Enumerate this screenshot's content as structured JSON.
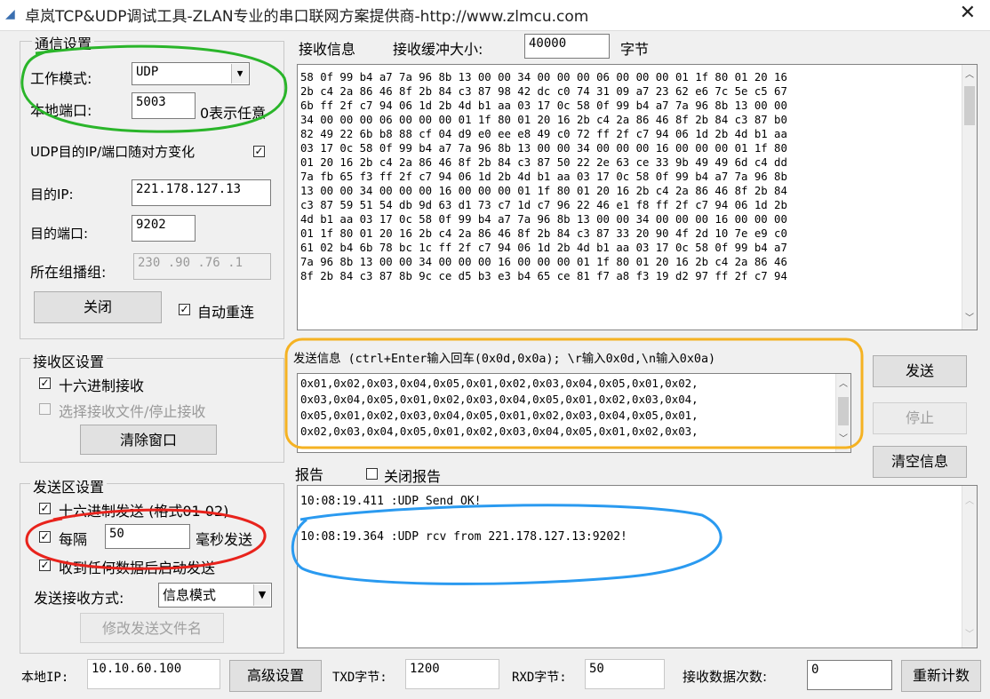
{
  "window": {
    "title": "卓岚TCP&UDP调试工具-ZLAN专业的串口联网方案提供商-http://www.zlmcu.com",
    "close": "✕"
  },
  "comm": {
    "group_title": "通信设置",
    "mode_label": "工作模式:",
    "mode_value": "UDP",
    "port_label": "本地端口:",
    "port_value": "5003",
    "port_hint": "0表示任意",
    "udp_change_label": "UDP目的IP/端口随对方变化",
    "udp_change_checked": "✓",
    "dest_ip_label": "目的IP:",
    "dest_ip_value": "221.178.127.13",
    "dest_port_label": "目的端口:",
    "dest_port_value": "9202",
    "multicast_label": "所在组播组:",
    "multicast_value": "230 .90 .76 .1",
    "close_button": "关闭",
    "auto_reconnect_label": "自动重连",
    "auto_reconnect_checked": "✓"
  },
  "recv_settings": {
    "group_title": "接收区设置",
    "hex_recv_label": "十六进制接收",
    "hex_recv_checked": "✓",
    "select_file_label": "选择接收文件/停止接收",
    "clear_button": "清除窗口"
  },
  "send_settings": {
    "group_title": "发送区设置",
    "hex_send_label": "十六进制发送 (格式01 02)",
    "hex_send_checked": "✓",
    "every_label": "每隔",
    "every_value": "50",
    "every_unit": "毫秒发送",
    "every_checked": "✓",
    "auto_send_label": "收到任何数据后启动发送",
    "auto_send_checked": "✓",
    "mode_label": "发送接收方式:",
    "mode_value": "信息模式",
    "modify_button": "修改发送文件名"
  },
  "receive": {
    "label": "接收信息",
    "buffer_label": "接收缓冲大小:",
    "buffer_value": "40000",
    "buffer_unit": "字节",
    "lines": [
      "58 0f 99 b4 a7 7a 96 8b 13 00 00 34 00 00 00 06 00 00 00 01 1f 80 01 20 16",
      "2b c4 2a 86 46 8f 2b 84 c3 87 98 42 dc c0 74 31 09 a7 23 62 e6 7c 5e c5 67",
      "6b ff 2f c7 94 06 1d 2b 4d b1 aa 03 17 0c 58 0f 99 b4 a7 7a 96 8b 13 00 00",
      "34 00 00 00 06 00 00 00 01 1f 80 01 20 16 2b c4 2a 86 46 8f 2b 84 c3 87 b0",
      "82 49 22 6b b8 88 cf 04 d9 e0 ee e8 49 c0 72 ff 2f c7 94 06 1d 2b 4d b1 aa",
      "03 17 0c 58 0f 99 b4 a7 7a 96 8b 13 00 00 34 00 00 00 16 00 00 00 01 1f 80",
      "01 20 16 2b c4 2a 86 46 8f 2b 84 c3 87 50 22 2e 63 ce 33 9b 49 49 6d c4 dd",
      "7a fb 65 f3 ff 2f c7 94 06 1d 2b 4d b1 aa 03 17 0c 58 0f 99 b4 a7 7a 96 8b",
      "13 00 00 34 00 00 00 16 00 00 00 01 1f 80 01 20 16 2b c4 2a 86 46 8f 2b 84",
      "c3 87 59 51 54 db 9d 63 d1 73 c7 1d c7 96 22 46 e1 f8 ff 2f c7 94 06 1d 2b",
      "4d b1 aa 03 17 0c 58 0f 99 b4 a7 7a 96 8b 13 00 00 34 00 00 00 16 00 00 00",
      "01 1f 80 01 20 16 2b c4 2a 86 46 8f 2b 84 c3 87 33 20 90 4f 2d 10 7e e9 c0",
      "61 02 b4 6b 78 bc 1c ff 2f c7 94 06 1d 2b 4d b1 aa 03 17 0c 58 0f 99 b4 a7",
      "7a 96 8b 13 00 00 34 00 00 00 16 00 00 00 01 1f 80 01 20 16 2b c4 2a 86 46",
      "8f 2b 84 c3 87 8b 9c ce d5 b3 e3 b4 65 ce 81 f7 a8 f3 19 d2 97 ff 2f c7 94"
    ]
  },
  "send": {
    "label": "发送信息 (ctrl+Enter输入回车(0x0d,0x0a); \\r输入0x0d,\\n输入0x0a)",
    "lines": [
      "0x01,0x02,0x03,0x04,0x05,0x01,0x02,0x03,0x04,0x05,0x01,0x02,",
      "0x03,0x04,0x05,0x01,0x02,0x03,0x04,0x05,0x01,0x02,0x03,0x04,",
      "0x05,0x01,0x02,0x03,0x04,0x05,0x01,0x02,0x03,0x04,0x05,0x01,",
      "0x02,0x03,0x04,0x05,0x01,0x02,0x03,0x04,0x05,0x01,0x02,0x03,"
    ],
    "send_button": "发送",
    "stop_button": "停止",
    "clear_info_button": "清空信息"
  },
  "report": {
    "label": "报告",
    "close_report_label": "关闭报告",
    "lines": [
      "10:08:19.411 :UDP Send OK!",
      "10:08:19.364 :UDP rcv from 221.178.127.13:9202!"
    ]
  },
  "status": {
    "local_ip_label": "本地IP:",
    "local_ip_value": "10.10.60.100",
    "advanced_button": "高级设置",
    "txd_label": "TXD字节:",
    "txd_value": "1200",
    "rxd_label": "RXD字节:",
    "rxd_value": "50",
    "recv_count_label": "接收数据次数:",
    "recv_count_value": "0",
    "reset_button": "重新计数"
  },
  "annotation_colors": {
    "green": "#2ab52a",
    "orange": "#f5b222",
    "red": "#e8231c",
    "blue": "#2a9af0"
  },
  "icons": {
    "dropdown": "chevron-down-icon",
    "scroll_up": "arrow-up-icon",
    "scroll_down": "arrow-down-icon"
  }
}
